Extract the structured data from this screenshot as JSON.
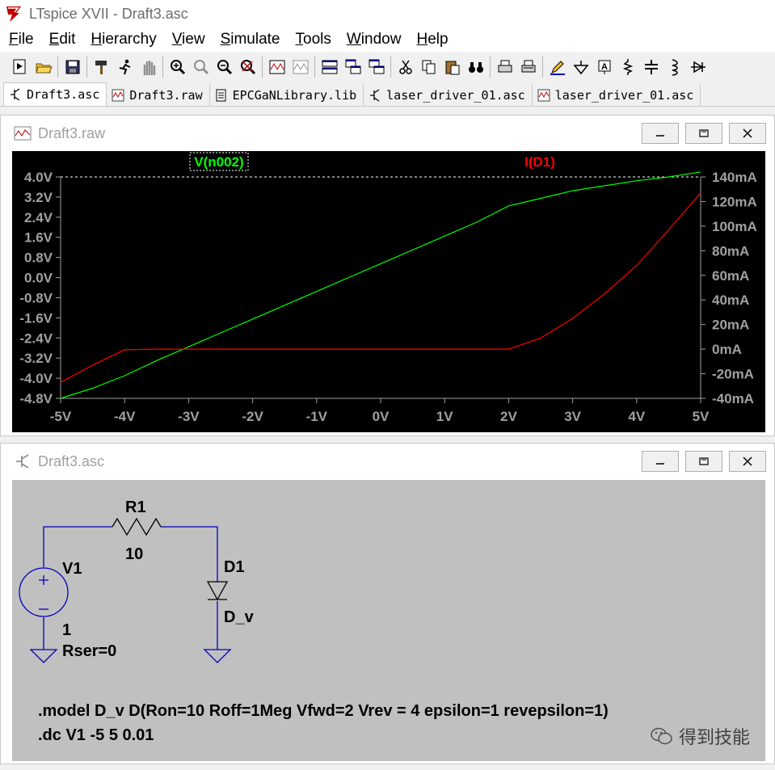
{
  "app": {
    "title": "LTspice XVII - Draft3.asc"
  },
  "menu": [
    "File",
    "Edit",
    "Hierarchy",
    "View",
    "Simulate",
    "Tools",
    "Window",
    "Help"
  ],
  "menu_underline": [
    "F",
    "E",
    "H",
    "V",
    "S",
    "T",
    "W",
    "H"
  ],
  "tabs": [
    {
      "label": "Draft3.asc",
      "icon": "schematic-icon",
      "active": true
    },
    {
      "label": "Draft3.raw",
      "icon": "waveform-icon",
      "active": false
    },
    {
      "label": "EPCGaNLibrary.lib",
      "icon": "document-icon",
      "active": false
    },
    {
      "label": "laser_driver_01.asc",
      "icon": "schematic-icon",
      "active": false
    },
    {
      "label": "laser_driver_01.asc",
      "icon": "waveform-icon",
      "active": false
    }
  ],
  "plot_window": {
    "title": "Draft3.raw"
  },
  "schematic_window": {
    "title": "Draft3.asc"
  },
  "chart_data": {
    "type": "line",
    "x": [
      -5,
      -4.5,
      -4,
      -3.5,
      -3,
      -2.5,
      -2,
      -1.5,
      -1,
      -0.5,
      0,
      0.5,
      1,
      1.5,
      2,
      2.5,
      3,
      3.5,
      4,
      4.5,
      5
    ],
    "series": [
      {
        "name": "V(n002)",
        "color": "#00ff00",
        "axis": "left",
        "values": [
          -4.8,
          -4.4,
          -3.9,
          -3.3,
          -2.75,
          -2.2,
          -1.65,
          -1.1,
          -0.55,
          0.0,
          0.55,
          1.1,
          1.65,
          2.2,
          2.85,
          3.15,
          3.45,
          3.65,
          3.85,
          4.0,
          4.2
        ]
      },
      {
        "name": "I(D1)",
        "color": "#ff0000",
        "axis": "right",
        "values": [
          -27,
          -13,
          -0.5,
          0,
          0,
          0,
          0,
          0,
          0,
          0,
          0,
          0,
          0,
          0,
          0,
          9,
          25,
          45,
          68,
          97,
          127
        ]
      }
    ],
    "xlabel": "",
    "ylabel": "",
    "xlim": [
      -5,
      5
    ],
    "ylim_left": [
      -4.8,
      4.0
    ],
    "ylim_right": [
      -40,
      140
    ],
    "x_ticks": [
      "-5V",
      "-4V",
      "-3V",
      "-2V",
      "-1V",
      "0V",
      "1V",
      "2V",
      "3V",
      "4V",
      "5V"
    ],
    "y_ticks_left": [
      "4.0V",
      "3.2V",
      "2.4V",
      "1.6V",
      "0.8V",
      "0.0V",
      "-0.8V",
      "-1.6V",
      "-2.4V",
      "-3.2V",
      "-4.0V",
      "-4.8V"
    ],
    "y_ticks_right": [
      "140mA",
      "120mA",
      "100mA",
      "80mA",
      "60mA",
      "40mA",
      "20mA",
      "0mA",
      "-20mA",
      "-40mA"
    ],
    "grid": false,
    "background": "#000000"
  },
  "schematic": {
    "r1_name": "R1",
    "r1_value": "10",
    "v1_name": "V1",
    "v1_value": "1",
    "v1_rser": "Rser=0",
    "d1_name": "D1",
    "d1_model": "D_v",
    "model_line": ".model D_v D(Ron=10 Roff=1Meg Vfwd=2 Vrev = 4 epsilon=1 revepsilon=1)",
    "dc_line": ".dc V1 -5 5 0.01",
    "wire_color": "#0000c0"
  },
  "watermark": "得到技能"
}
